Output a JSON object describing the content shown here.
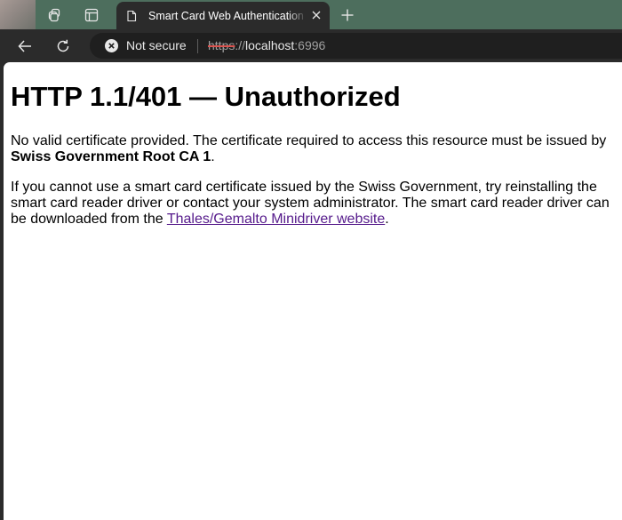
{
  "browser": {
    "tab": {
      "title": "Smart Card Web Authentication Test",
      "icon": "document-icon"
    },
    "address_bar": {
      "security_label": "Not secure",
      "security_icon": "not-secure-icon",
      "url_scheme": "https",
      "url_separator": "://",
      "url_host": "localhost",
      "url_port": ":6996"
    },
    "colors": {
      "tabstrip": "#4d6e5d",
      "toolbar": "#2b2b2b",
      "link": "#551a8b"
    }
  },
  "page": {
    "heading": "HTTP 1.1/401 — Unauthorized",
    "p1_text": "No valid certificate provided. The certificate required to access this resource must be issued by ",
    "p1_bold": "Swiss Government Root CA 1",
    "p1_end": ".",
    "p2_text": "If you cannot use a smart card certificate issued by the Swiss Government, try reinstalling the smart card reader driver or contact your system administrator. The smart card reader driver can be downloaded from the ",
    "p2_link": "Thales/Gemalto Minidriver website",
    "p2_end": "."
  }
}
